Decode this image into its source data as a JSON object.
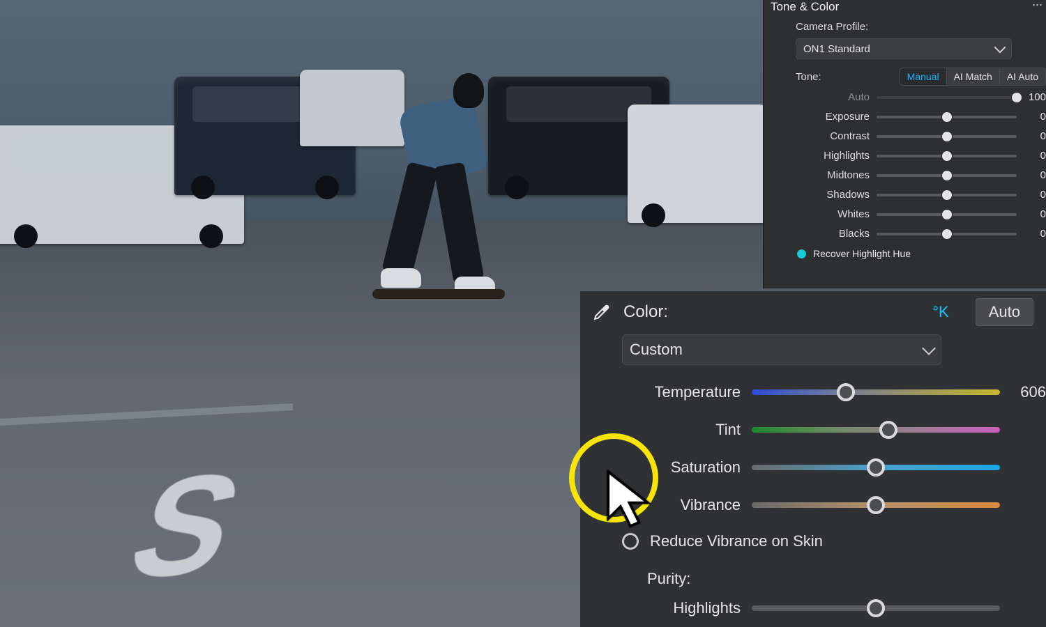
{
  "panelTop": {
    "title": "Tone & Color",
    "cameraProfileLabel": "Camera Profile:",
    "cameraProfileValue": "ON1 Standard",
    "toneLabel": "Tone:",
    "modes": {
      "manual": "Manual",
      "aimatch": "AI Match",
      "aiauto": "AI Auto"
    },
    "auto": {
      "label": "Auto",
      "value": "100",
      "thumbPct": 100
    },
    "sliders": [
      {
        "label": "Exposure",
        "value": "0",
        "thumbPct": 50
      },
      {
        "label": "Contrast",
        "value": "0",
        "thumbPct": 50
      },
      {
        "label": "Highlights",
        "value": "0",
        "thumbPct": 50
      },
      {
        "label": "Midtones",
        "value": "0",
        "thumbPct": 50
      },
      {
        "label": "Shadows",
        "value": "0",
        "thumbPct": 50
      },
      {
        "label": "Whites",
        "value": "0",
        "thumbPct": 50
      },
      {
        "label": "Blacks",
        "value": "0",
        "thumbPct": 50
      }
    ],
    "recoverLabel": "Recover Highlight Hue"
  },
  "panelColor": {
    "title": "Color:",
    "kelvin": "°K",
    "auto": "Auto",
    "presetValue": "Custom",
    "sliders": {
      "temperature": {
        "label": "Temperature",
        "value": "606",
        "thumbPct": 38
      },
      "tint": {
        "label": "Tint",
        "value": "",
        "thumbPct": 55
      },
      "saturation": {
        "label": "Saturation",
        "value": "",
        "thumbPct": 50
      },
      "vibrance": {
        "label": "Vibrance",
        "value": "",
        "thumbPct": 50
      }
    },
    "reduceSkin": "Reduce Vibrance on Skin",
    "purityLabel": "Purity:",
    "puritySliders": {
      "highlights": "Highlights"
    }
  },
  "colors": {
    "accent": "#19b3ff",
    "highlightRing": "#f6e40a"
  }
}
